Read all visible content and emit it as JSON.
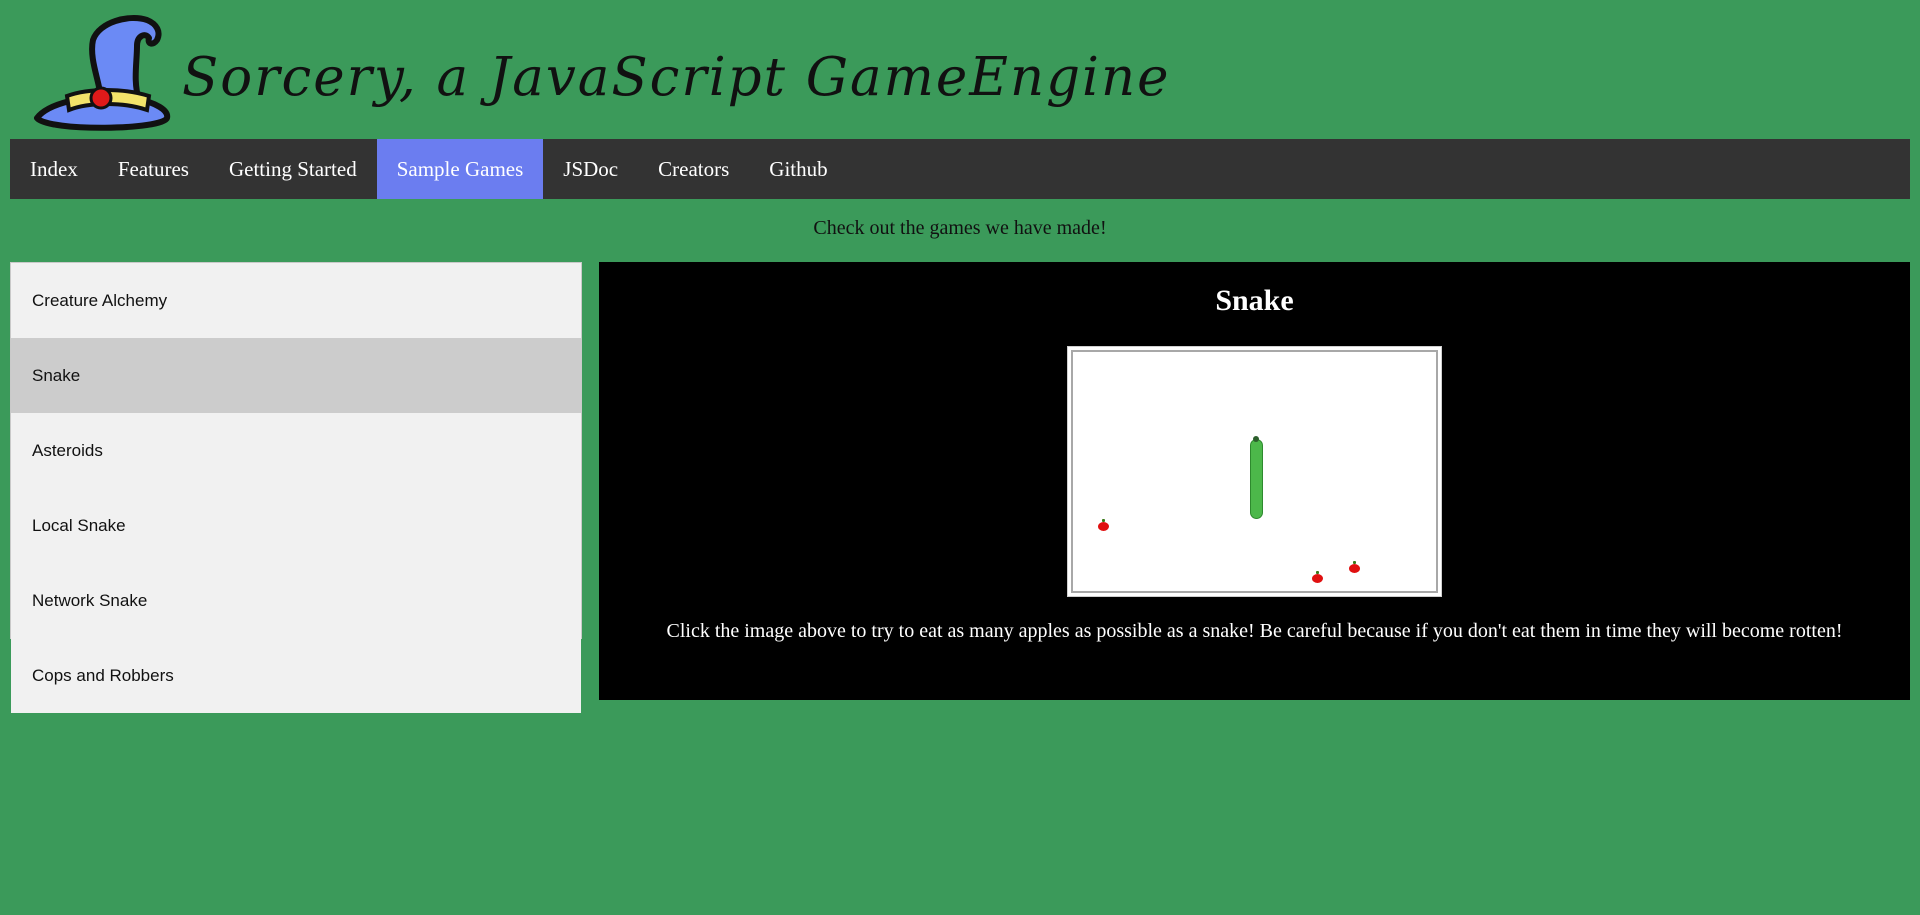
{
  "header": {
    "logo_icon": "wizard-hat-icon",
    "logo_text": "Sorcery, a JavaScript GameEngine"
  },
  "nav": {
    "items": [
      {
        "label": "Index"
      },
      {
        "label": "Features"
      },
      {
        "label": "Getting Started"
      },
      {
        "label": "Sample Games",
        "active": true
      },
      {
        "label": "JSDoc"
      },
      {
        "label": "Creators"
      },
      {
        "label": "Github"
      }
    ],
    "active_color": "#6b7df0",
    "background_color": "#333333"
  },
  "tagline": "Check out the games we have made!",
  "sidebar": {
    "items": [
      {
        "label": "Creature Alchemy"
      },
      {
        "label": "Snake",
        "active": true
      },
      {
        "label": "Asteroids"
      },
      {
        "label": "Local Snake"
      },
      {
        "label": "Network Snake"
      },
      {
        "label": "Cops and Robbers"
      }
    ]
  },
  "game": {
    "title": "Snake",
    "description": "Click the image above to try to eat as many apples as possible as a snake! Be careful because if you don't eat them in time they will become rotten!"
  },
  "colors": {
    "page_background": "#3b9a5a",
    "panel_background": "#000000",
    "sidebar_background": "#f1f1f1",
    "sidebar_active": "#cccccc",
    "snake": "#4cb84a",
    "apple": "#e01010"
  }
}
